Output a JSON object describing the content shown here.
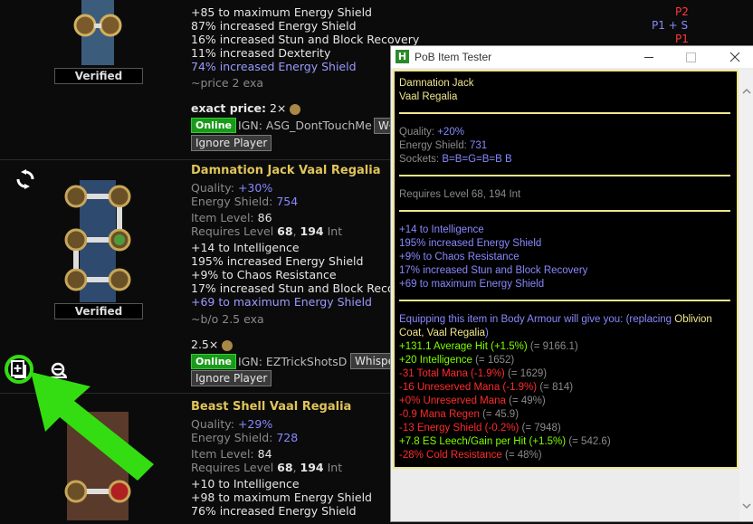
{
  "listing1": {
    "mods": [
      "+85 to maximum Energy Shield",
      "87% increased Energy Shield",
      "16% increased Stun and Block Recovery",
      "11% increased Dexterity",
      "74% increased Energy Shield"
    ],
    "tags": [
      "P2",
      "P1 + S",
      "P1"
    ],
    "verified": "Verified",
    "price_note": "~price 2 exa",
    "exact_price_label": "exact price:",
    "exact_price_value": "2×",
    "online": "Online",
    "ign": "IGN: ASG_DontTouchMe",
    "whisper_partial": "Wł",
    "ignore": "Ignore Player"
  },
  "listing2": {
    "title": "Damnation Jack Vaal Regalia",
    "quality_label": "Quality:",
    "quality": "+30%",
    "es_label": "Energy Shield:",
    "es": "754",
    "ilvl_label": "Item Level:",
    "ilvl": "86",
    "req_label": "Requires Level",
    "req_level": "68",
    "req_int": "194",
    "req_int_label": "Int",
    "mods": [
      "+14 to Intelligence",
      "195% increased Energy Shield",
      "+9% to Chaos Resistance",
      "17% increased Stun and Block Reco",
      "+69 to maximum Energy Shield"
    ],
    "verified": "Verified",
    "price_note": "~b/o 2.5 exa",
    "price": "2.5×",
    "online": "Online",
    "ign": "IGN: EZTrickShotsD",
    "whisper": "Whispe",
    "ignore": "Ignore Player"
  },
  "listing3": {
    "title": "Beast Shell Vaal Regalia",
    "quality_label": "Quality:",
    "quality": "+29%",
    "es_label": "Energy Shield:",
    "es": "728",
    "ilvl_label": "Item Level:",
    "ilvl": "84",
    "req_label": "Requires Level",
    "req_level": "68",
    "req_int": "194",
    "req_int_label": "Int",
    "mods": [
      "+10 to Intelligence",
      "+98 to maximum Energy Shield",
      "76% increased Energy Shield"
    ]
  },
  "pob": {
    "window_title": "PoB Item Tester",
    "item_name": "Damnation Jack",
    "item_base": "Vaal Regalia",
    "quality_label": "Quality:",
    "quality": "+20%",
    "es_label": "Energy Shield:",
    "es": "731",
    "sockets_label": "Sockets:",
    "sockets": "B=B=G=B=B B",
    "requires": "Requires Level 68, 194 Int",
    "mods": [
      "+14 to Intelligence",
      "195% increased Energy Shield",
      "+9% to Chaos Resistance",
      "17% increased Stun and Block Recovery",
      "+69 to maximum Energy Shield"
    ],
    "equip_line1a": "Equipping this item in Body Armour will give you: (replacing",
    "equip_line1b": "Oblivion",
    "equip_line2a": "Coat, Vaal Regalia",
    "equip_line2b": ")",
    "stats": [
      {
        "text": "+131.1 Average Hit (+1.5%)",
        "after": "(= 9166.1)",
        "color": "#7fff00"
      },
      {
        "text": "+20 Intelligence",
        "after": "(= 1652)",
        "color": "#7fff00"
      },
      {
        "text": "-31 Total Mana (-1.9%)",
        "after": "(= 1629)",
        "color": "#ff2a2a"
      },
      {
        "text": "-16 Unreserved Mana (-1.9%)",
        "after": "(= 814)",
        "color": "#ff2a2a"
      },
      {
        "text": "+0% Unreserved Mana",
        "after": "(= 49%)",
        "color": "#ff2a2a"
      },
      {
        "text": "-0.9 Mana Regen",
        "after": "(= 45.9)",
        "color": "#ff2a2a"
      },
      {
        "text": "-13 Energy Shield (-0.2%)",
        "after": "(= 7948)",
        "color": "#ff2a2a"
      },
      {
        "text": "+7.8 ES Leech/Gain per Hit (+1.5%)",
        "after": "(= 542.6)",
        "color": "#7fff00"
      },
      {
        "text": "-28% Cold Resistance",
        "after": "(= 48%)",
        "color": "#ff2a2a"
      }
    ]
  },
  "colors": {
    "highlight_green": "#33dd11",
    "pob_border": "#f0e68c",
    "online_green": "#1a9a1a"
  }
}
